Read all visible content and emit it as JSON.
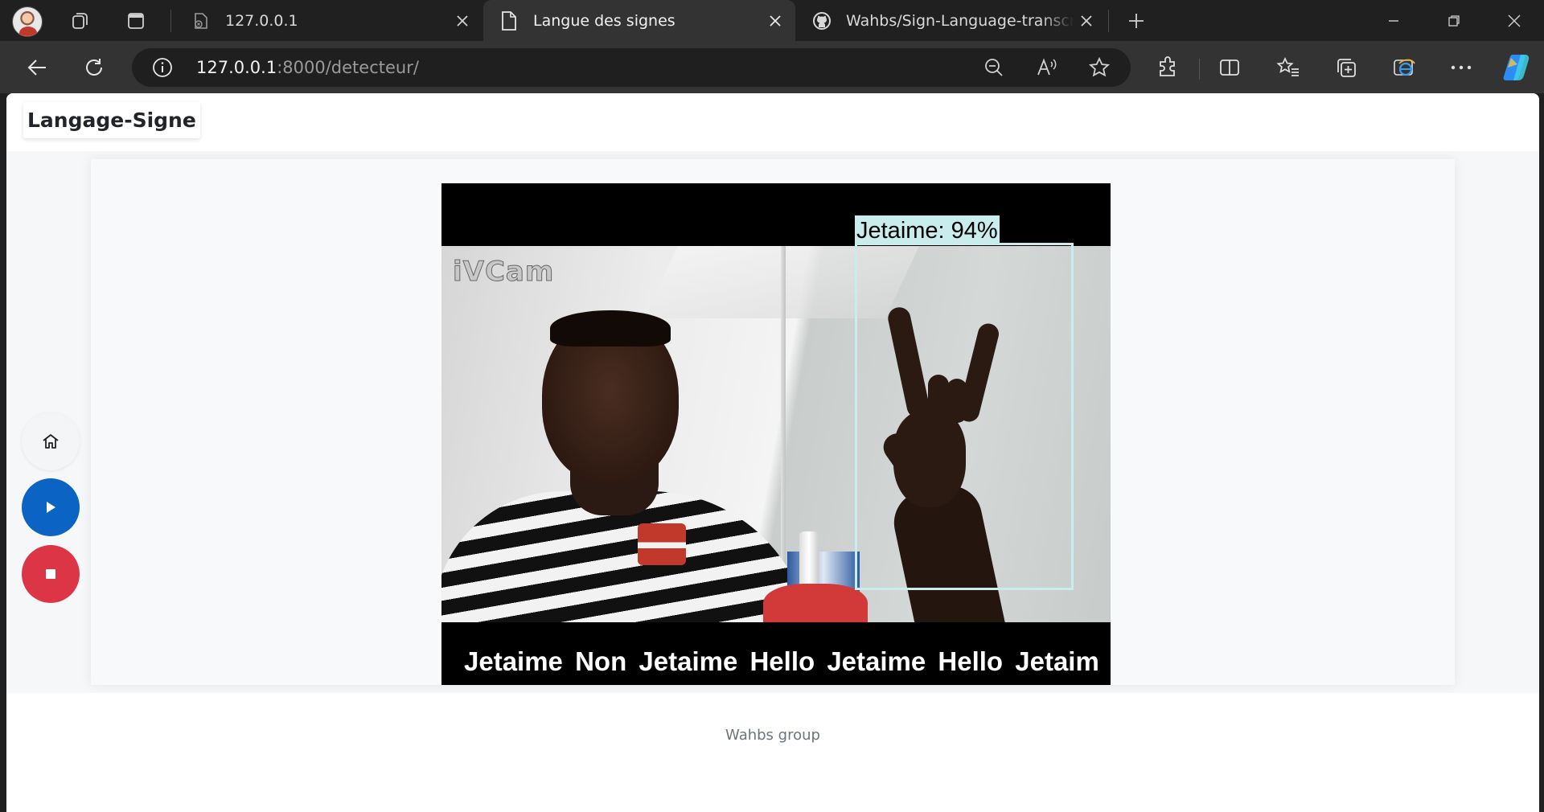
{
  "browser": {
    "tabs": [
      {
        "title": "127.0.0.1",
        "favicon": "page-error-icon",
        "active": false
      },
      {
        "title": "Langue des signes",
        "favicon": "document-icon",
        "active": true
      },
      {
        "title": "Wahbs/Sign-Language-transcript",
        "favicon": "github-icon",
        "active": false
      }
    ],
    "address": {
      "host": "127.0.0.1",
      "rest": ":8000/detecteur/"
    }
  },
  "page": {
    "brand": "Langage-Signe",
    "video": {
      "watermark": "iVCam",
      "detection_label": "Jetaime: 94%",
      "transcript": "Jetaime Non Jetaime Hello Jetaime Hello Jetaim"
    },
    "controls": [
      {
        "name": "home",
        "icon": "home-icon",
        "color": "#f4f5f7"
      },
      {
        "name": "start",
        "icon": "play-icon",
        "color": "#0b63c4"
      },
      {
        "name": "stop",
        "icon": "stop-icon",
        "color": "#dc3545"
      }
    ],
    "footer": "Wahbs group"
  }
}
